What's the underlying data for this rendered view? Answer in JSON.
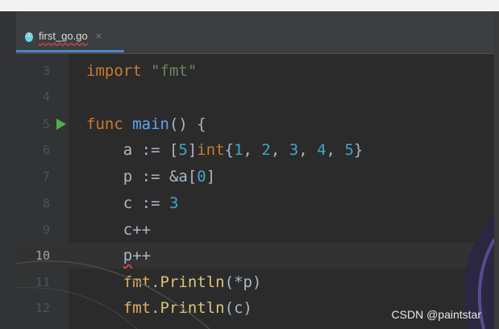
{
  "tab": {
    "filename": "first_go.go",
    "close_glyph": "×"
  },
  "lines": [
    {
      "num": "3"
    },
    {
      "num": "4"
    },
    {
      "num": "5"
    },
    {
      "num": "6"
    },
    {
      "num": "7"
    },
    {
      "num": "8"
    },
    {
      "num": "9"
    },
    {
      "num": "10"
    },
    {
      "num": "11"
    },
    {
      "num": "12"
    }
  ],
  "code": {
    "l3": {
      "kw": "import",
      "sp": " ",
      "str": "\"fmt\""
    },
    "l5": {
      "kw": "func",
      "sp": " ",
      "fn": "main",
      "rest": "() {"
    },
    "l6": {
      "a": "    a := [",
      "n5": "5",
      "b": "]",
      "kw": "int",
      "c": "{",
      "n1": "1",
      "s1": ", ",
      "n2": "2",
      "s2": ", ",
      "n3": "3",
      "s3": ", ",
      "n4": "4",
      "s4": ", ",
      "n5b": "5",
      "d": "}"
    },
    "l7": {
      "a": "    p := &a[",
      "n": "0",
      "b": "]"
    },
    "l8": {
      "a": "    c := ",
      "n": "3"
    },
    "l9": {
      "a": "    c++"
    },
    "l10": {
      "ind": "    ",
      "p": "p",
      "rest": "++"
    },
    "l11": {
      "ind": "    ",
      "pkg": "fmt",
      "dot": ".",
      "call": "Println",
      "rest": "(*p)"
    },
    "l12": {
      "ind": "    ",
      "pkg": "fmt",
      "dot": ".",
      "call": "Println",
      "rest": "(c)"
    }
  },
  "watermark": "CSDN @paintstar",
  "icons": {
    "file": "gopher-file-icon",
    "run": "run-gutter-icon"
  },
  "colors": {
    "background": "#2b2b2b",
    "keyword": "#cc7832",
    "string": "#6a8759",
    "number": "#3fa7c8",
    "function": "#57a8f5"
  }
}
